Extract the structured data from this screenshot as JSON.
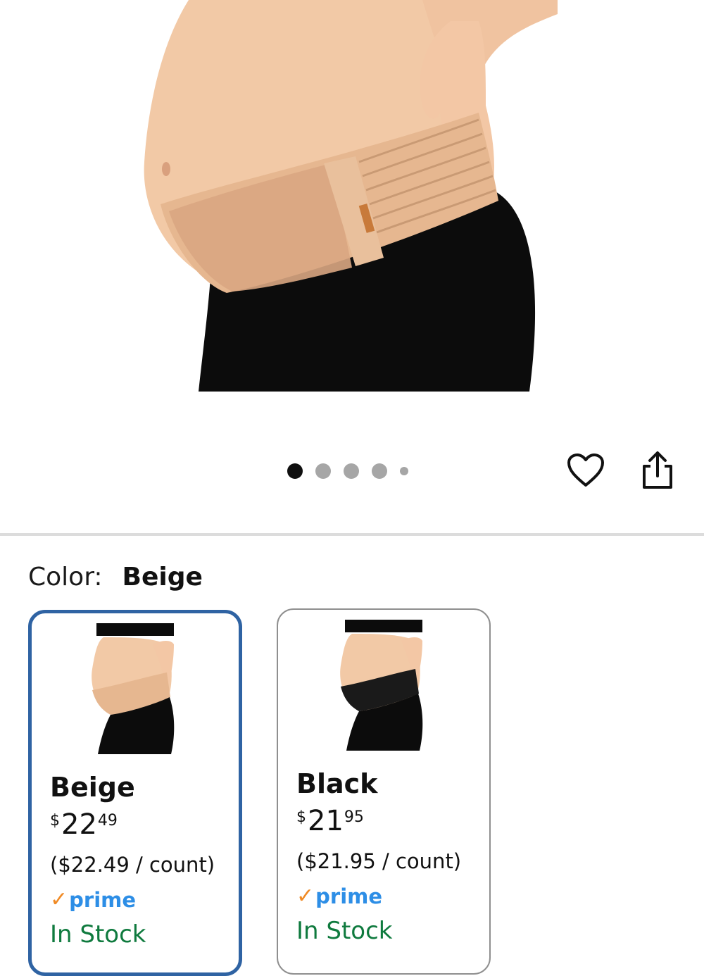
{
  "gallery": {
    "image_alt": "Maternity belly band worn by pregnant woman",
    "dots": [
      {
        "state": "active"
      },
      {
        "state": "inactive"
      },
      {
        "state": "inactive"
      },
      {
        "state": "inactive"
      },
      {
        "state": "small"
      }
    ],
    "favorite_icon": "heart-outline-icon",
    "share_icon": "share-icon"
  },
  "variation": {
    "label": "Color:",
    "selected_value": "Beige"
  },
  "swatches": [
    {
      "name": "Beige",
      "price_symbol": "$",
      "price_whole": "22",
      "price_fraction": "49",
      "unit_price": "($22.49 / count)",
      "prime_check": "✓",
      "prime_label": "prime",
      "availability": "In Stock",
      "selected": true
    },
    {
      "name": "Black",
      "price_symbol": "$",
      "price_whole": "21",
      "price_fraction": "95",
      "unit_price": "($21.95 / count)",
      "prime_check": "✓",
      "prime_label": "prime",
      "availability": "In Stock",
      "selected": false
    }
  ],
  "colors": {
    "selected_border": "#2f63a3",
    "prime_blue": "#2d8ee6",
    "prime_check": "#f08a24",
    "in_stock_green": "#0f7a3e"
  }
}
